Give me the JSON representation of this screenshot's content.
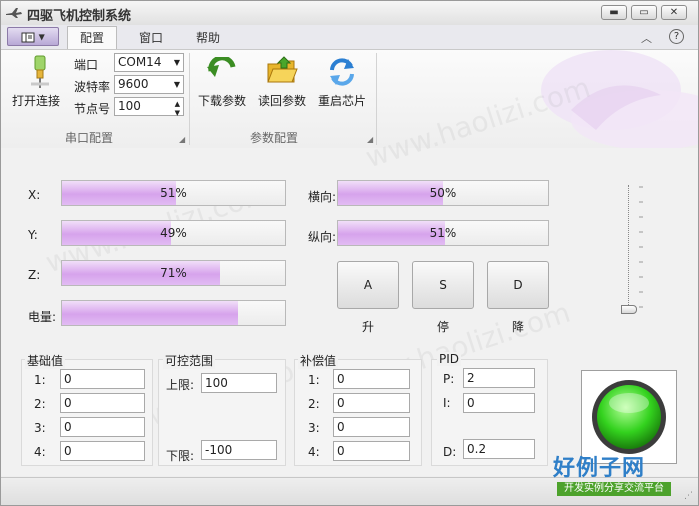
{
  "window": {
    "title": "四驱飞机控制系统",
    "buttons": {
      "minimize": "▬",
      "maximize": "▭",
      "close": "✕"
    }
  },
  "ribbon": {
    "tabs": [
      {
        "label": "配置",
        "active": true
      },
      {
        "label": "窗口",
        "active": false
      },
      {
        "label": "帮助",
        "active": false
      }
    ],
    "collapse_glyph": "︿",
    "help_glyph": "?",
    "serial_group": {
      "caption": "串口配置",
      "open_button": "打开连接",
      "port_label": "端口",
      "port_value": "COM14",
      "baud_label": "波特率",
      "baud_value": "9600",
      "node_label": "节点号",
      "node_value": "100"
    },
    "param_group": {
      "caption": "参数配置",
      "download_button": "下载参数",
      "readback_button": "读回参数",
      "restart_button": "重启芯片"
    }
  },
  "gauges": {
    "x": {
      "label": "X:",
      "percent": 51,
      "text": "51%"
    },
    "y": {
      "label": "Y:",
      "percent": 49,
      "text": "49%"
    },
    "z": {
      "label": "Z:",
      "percent": 71,
      "text": "71%"
    },
    "battery": {
      "label": "电量:",
      "percent": 79,
      "text": ""
    },
    "lateral": {
      "label": "横向:",
      "percent": 50,
      "text": "50%"
    },
    "longitudinal": {
      "label": "纵向:",
      "percent": 51,
      "text": "51%"
    }
  },
  "controls": {
    "a": {
      "label": "A",
      "caption": "升"
    },
    "s": {
      "label": "S",
      "caption": "停"
    },
    "d": {
      "label": "D",
      "caption": "降"
    }
  },
  "throttle": {
    "level": 0.0
  },
  "base": {
    "title": "基础值",
    "rows": [
      {
        "label": "1:",
        "value": "0"
      },
      {
        "label": "2:",
        "value": "0"
      },
      {
        "label": "3:",
        "value": "0"
      },
      {
        "label": "4:",
        "value": "0"
      }
    ]
  },
  "range": {
    "title": "可控范围",
    "upper_label": "上限:",
    "upper_value": "100",
    "lower_label": "下限:",
    "lower_value": "-100"
  },
  "compensation": {
    "title": "补偿值",
    "rows": [
      {
        "label": "1:",
        "value": "0"
      },
      {
        "label": "2:",
        "value": "0"
      },
      {
        "label": "3:",
        "value": "0"
      },
      {
        "label": "4:",
        "value": "0"
      }
    ]
  },
  "pid": {
    "title": "PID",
    "p_label": "P:",
    "p_value": "2",
    "i_label": "I:",
    "i_value": "0",
    "d_label": "D:",
    "d_value": "0.2"
  },
  "status": {
    "lamp_color": "#33d21e"
  },
  "watermark": {
    "text": "www.haolizi.com",
    "brand_main": "好例子网",
    "brand_sub": "开发实例分享交流平台"
  },
  "colors": {
    "bar_fill": "#d6a3ec",
    "accent": "#8c7aa8"
  }
}
